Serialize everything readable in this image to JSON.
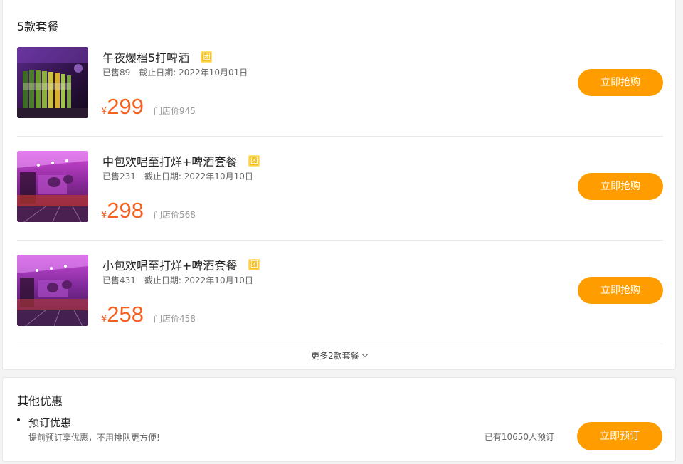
{
  "packages": {
    "title": "5款套餐",
    "currency_symbol": "¥",
    "buy_label": "立即抢购",
    "tuan_badge": "团",
    "deals": [
      {
        "name": "午夜爆档5打啤酒",
        "sold": "已售89",
        "deadline": "截止日期: 2022年10月01日",
        "price": "299",
        "store_price": "门店价945",
        "image": "beer-bottles-photo"
      },
      {
        "name": "中包欢唱至打烊+啤酒套餐",
        "sold": "已售231",
        "deadline": "截止日期: 2022年10月10日",
        "price": "298",
        "store_price": "门店价568",
        "image": "ktv-room-photo"
      },
      {
        "name": "小包欢唱至打烊+啤酒套餐",
        "sold": "已售431",
        "deadline": "截止日期: 2022年10月10日",
        "price": "258",
        "store_price": "门店价458",
        "image": "ktv-room-photo"
      }
    ],
    "more_label": "更多2款套餐",
    "more_icon": "chevron-down-icon"
  },
  "other_offers": {
    "title": "其他优惠",
    "items": [
      {
        "name": "预订优惠",
        "desc": "提前预订享优惠，不用排队更方便!",
        "count": "已有10650人预订",
        "button_label": "立即预订"
      }
    ]
  },
  "colors": {
    "accent": "#ff9d00",
    "price": "#f76120",
    "badge": "#f6c21b"
  }
}
